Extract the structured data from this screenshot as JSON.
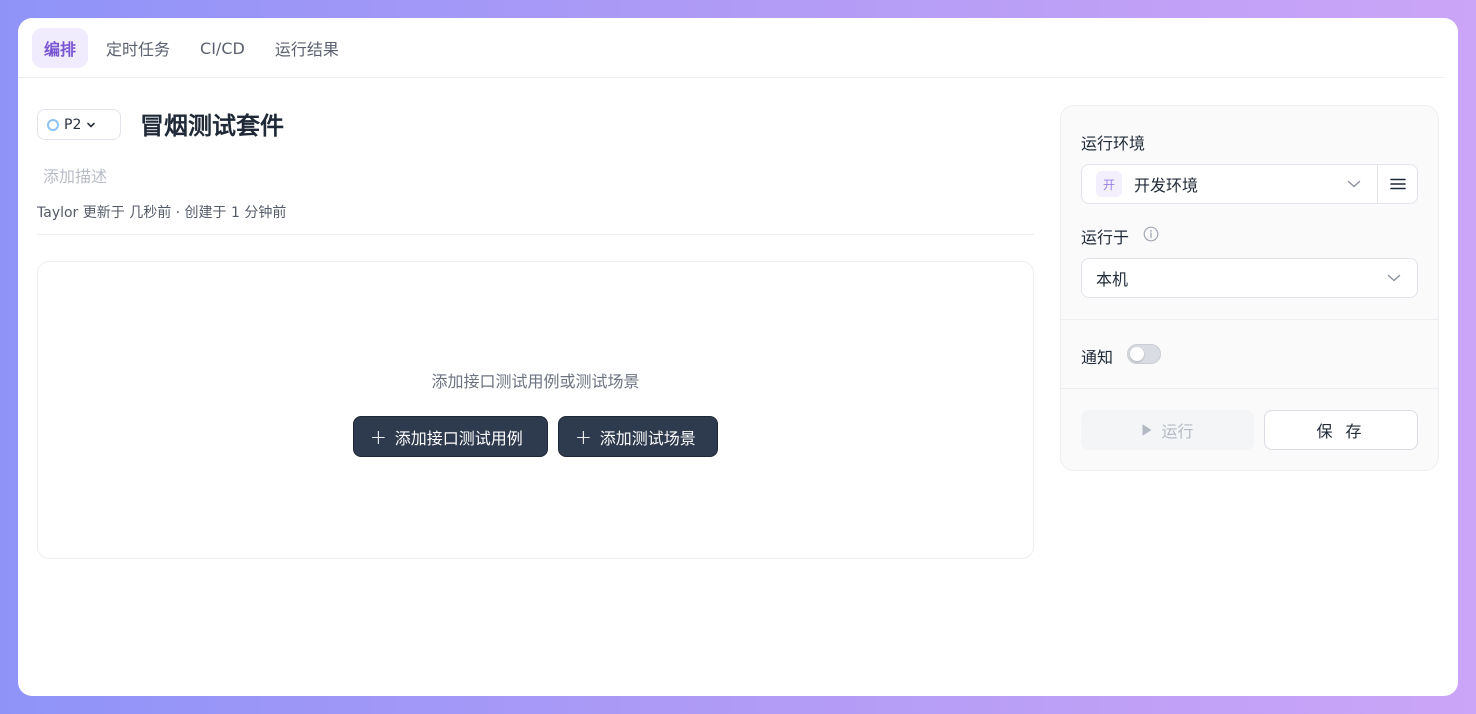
{
  "tabs": [
    {
      "label": "编排",
      "active": true
    },
    {
      "label": "定时任务",
      "active": false
    },
    {
      "label": "CI/CD",
      "active": false
    },
    {
      "label": "运行结果",
      "active": false
    }
  ],
  "header": {
    "priority": "P2",
    "title": "冒烟测试套件",
    "description_placeholder": "添加描述",
    "meta": "Taylor 更新于 几秒前 · 创建于 1 分钟前"
  },
  "empty_state": {
    "message": "添加接口测试用例或测试场景",
    "add_case_label": "添加接口测试用例",
    "add_scene_label": "添加测试场景"
  },
  "panel": {
    "env_label": "运行环境",
    "env_badge": "开",
    "env_value": "开发环境",
    "run_on_label": "运行于",
    "run_on_value": "本机",
    "notify_label": "通知",
    "notify_enabled": false,
    "run_label": "运行",
    "save_label": "保 存"
  },
  "colors": {
    "accent": "#7a57d1",
    "dark_button": "#2e3a4d"
  }
}
